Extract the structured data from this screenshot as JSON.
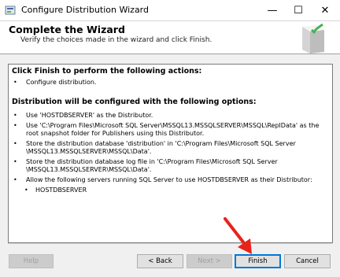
{
  "window": {
    "title": "Configure Distribution Wizard",
    "minimize": "—",
    "maximize": "☐",
    "close": "✕"
  },
  "header": {
    "title": "Complete the Wizard",
    "subtitle": "Verify the choices made in the wizard and click Finish."
  },
  "summary": {
    "actions_title": "Click Finish to perform the following actions:",
    "actions": [
      "Configure distribution."
    ],
    "options_title": "Distribution will be configured with the following options:",
    "options": [
      "Use 'HOSTDBSERVER' as the Distributor.",
      "Use 'C:\\Program Files\\Microsoft SQL Server\\MSSQL13.MSSQLSERVER\\MSSQL\\ReplData' as the root snapshot folder for Publishers using this Distributor.",
      "Store the distribution database 'distribution' in 'C:\\Program Files\\Microsoft SQL Server \\MSSQL13.MSSQLSERVER\\MSSQL\\Data'.",
      "Store the distribution database log file in 'C:\\Program Files\\Microsoft SQL Server \\MSSQL13.MSSQLSERVER\\MSSQL\\Data'.",
      "Allow the following servers running SQL Server to use HOSTDBSERVER as their Distributor:"
    ],
    "servers": [
      "HOSTDBSERVER"
    ],
    "bullet": "•"
  },
  "buttons": {
    "help": "Help",
    "back": "< Back",
    "next": "Next >",
    "finish": "Finish",
    "cancel": "Cancel"
  },
  "colors": {
    "arrow": "#e8231b",
    "focus": "#0078d7"
  }
}
